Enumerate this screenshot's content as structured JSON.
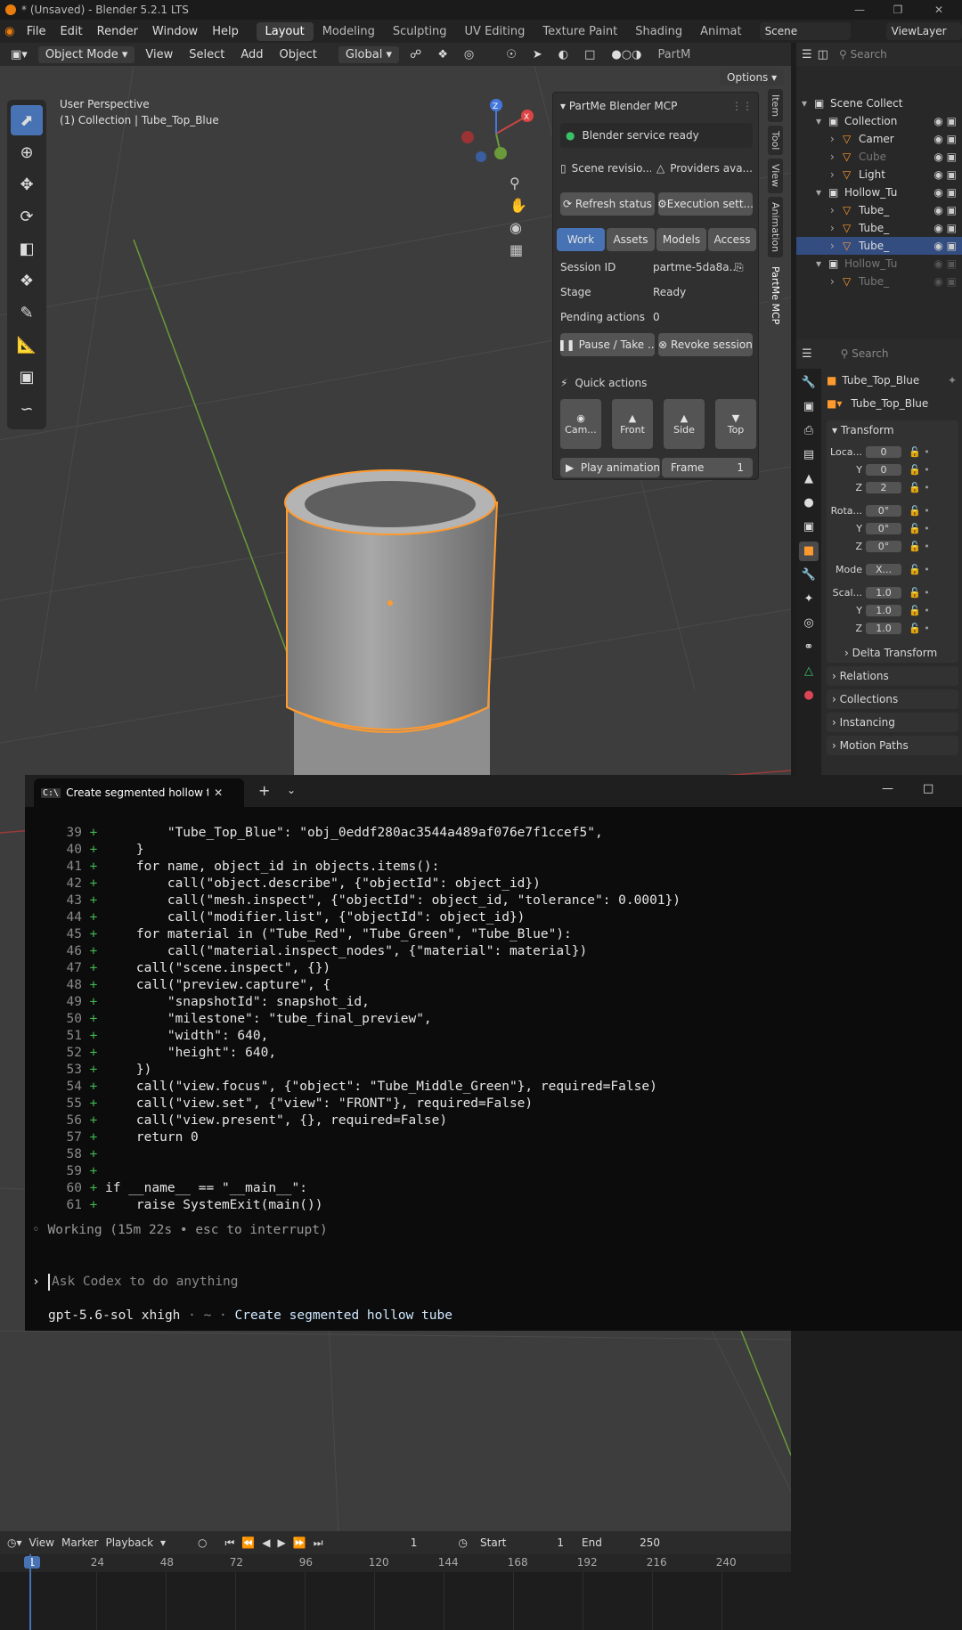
{
  "titlebar": {
    "title": "* (Unsaved) - Blender 5.2.1 LTS"
  },
  "menubar": {
    "menus": [
      "File",
      "Edit",
      "Render",
      "Window",
      "Help"
    ],
    "workspaces": [
      "Layout",
      "Modeling",
      "Sculpting",
      "UV Editing",
      "Texture Paint",
      "Shading",
      "Animat"
    ],
    "scene": "Scene",
    "view_layer": "ViewLayer"
  },
  "view3d_header": {
    "mode": "Object Mode",
    "menus": [
      "View",
      "Select",
      "Add",
      "Object"
    ],
    "orientation": "Global",
    "options": "Options",
    "partme_tab": "PartM"
  },
  "viewport": {
    "perspective": "User Perspective",
    "collection_info": "(1) Collection | Tube_Top_Blue",
    "gizmo": {
      "x_label": "X",
      "z_label": "Z"
    }
  },
  "npanel": {
    "title": "PartMe Blender MCP",
    "status": "Blender service ready",
    "scene_revision": "Scene revisio...",
    "providers": "Providers ava...",
    "refresh": "Refresh status",
    "execution": "Execution sett...",
    "tabs": [
      "Work",
      "Assets",
      "Models",
      "Access"
    ],
    "session_label": "Session ID",
    "session_value": "partme-5da8a...",
    "stage_label": "Stage",
    "stage_value": "Ready",
    "pending_label": "Pending actions",
    "pending_value": "0",
    "pause": "Pause / Take ...",
    "revoke": "Revoke session",
    "quick_actions": "Quick actions",
    "views": [
      "Cam...",
      "Front",
      "Side",
      "Top"
    ],
    "play": "Play animation",
    "frame_label": "Frame",
    "frame_value": "1"
  },
  "side_tabs": [
    "Item",
    "Tool",
    "View",
    "Animation",
    "PartMe MCP"
  ],
  "outliner": {
    "search_placeholder": "Search",
    "rows": [
      {
        "label": "Scene Collect",
        "indent": 0
      },
      {
        "label": "Collection",
        "indent": 1
      },
      {
        "label": "Camer",
        "indent": 2
      },
      {
        "label": "Cube",
        "indent": 2
      },
      {
        "label": "Light",
        "indent": 2
      },
      {
        "label": "Hollow_Tu",
        "indent": 1
      },
      {
        "label": "Tube_",
        "indent": 2
      },
      {
        "label": "Tube_",
        "indent": 2
      },
      {
        "label": "Tube_",
        "indent": 2
      },
      {
        "label": "Hollow_Tu",
        "indent": 1
      },
      {
        "label": "Tube_",
        "indent": 2
      }
    ]
  },
  "properties": {
    "search_placeholder": "Search",
    "object_name": "Tube_Top_Blue",
    "name_field": "Tube_Top_Blue",
    "transform": "Transform",
    "location_label": "Loca...",
    "location": [
      "0",
      "0",
      "2"
    ],
    "rotation_label": "Rota...",
    "rotation": [
      "0°",
      "0°",
      "0°"
    ],
    "mode_label": "Mode",
    "mode_value": "X...",
    "scale_label": "Scal...",
    "scale": [
      "1.0",
      "1.0",
      "1.0"
    ],
    "axis_y": "Y",
    "axis_z": "Z",
    "delta": "Delta Transform",
    "sections": [
      "Relations",
      "Collections",
      "Instancing",
      "Motion Paths"
    ]
  },
  "terminal": {
    "tab_title": "Create segmented hollow t",
    "lines": [
      {
        "n": "39",
        "t": "        \"Tube_Top_Blue\": \"obj_0eddf280ac3544a489af076e7f1ccef5\","
      },
      {
        "n": "40",
        "t": "    }"
      },
      {
        "n": "41",
        "t": "    for name, object_id in objects.items():"
      },
      {
        "n": "42",
        "t": "        call(\"object.describe\", {\"objectId\": object_id})"
      },
      {
        "n": "43",
        "t": "        call(\"mesh.inspect\", {\"objectId\": object_id, \"tolerance\": 0.0001})"
      },
      {
        "n": "44",
        "t": "        call(\"modifier.list\", {\"objectId\": object_id})"
      },
      {
        "n": "45",
        "t": "    for material in (\"Tube_Red\", \"Tube_Green\", \"Tube_Blue\"):"
      },
      {
        "n": "46",
        "t": "        call(\"material.inspect_nodes\", {\"material\": material})"
      },
      {
        "n": "47",
        "t": "    call(\"scene.inspect\", {})"
      },
      {
        "n": "48",
        "t": "    call(\"preview.capture\", {"
      },
      {
        "n": "49",
        "t": "        \"snapshotId\": snapshot_id,"
      },
      {
        "n": "50",
        "t": "        \"milestone\": \"tube_final_preview\","
      },
      {
        "n": "51",
        "t": "        \"width\": 640,"
      },
      {
        "n": "52",
        "t": "        \"height\": 640,"
      },
      {
        "n": "53",
        "t": "    })"
      },
      {
        "n": "54",
        "t": "    call(\"view.focus\", {\"object\": \"Tube_Middle_Green\"}, required=False)"
      },
      {
        "n": "55",
        "t": "    call(\"view.set\", {\"view\": \"FRONT\"}, required=False)"
      },
      {
        "n": "56",
        "t": "    call(\"view.present\", {}, required=False)"
      },
      {
        "n": "57",
        "t": "    return 0"
      },
      {
        "n": "58",
        "t": ""
      },
      {
        "n": "59",
        "t": ""
      },
      {
        "n": "60",
        "t": "if __name__ == \"__main__\":"
      },
      {
        "n": "61",
        "t": "    raise SystemExit(main())"
      }
    ],
    "working": "◦ Working (15m 22s • esc to interrupt)",
    "prompt_placeholder": "Ask Codex to do anything",
    "status_model": "gpt-5.6-sol xhigh",
    "status_sep": " · ~ · ",
    "status_task": "Create segmented hollow tube"
  },
  "timeline": {
    "menus": [
      "View",
      "Marker",
      "Playback"
    ],
    "current_frame": "1",
    "start_label": "Start",
    "start_value": "1",
    "end_label": "End",
    "end_value": "250",
    "ticks": [
      "1",
      "24",
      "48",
      "72",
      "96",
      "120",
      "144",
      "168",
      "192",
      "216",
      "240"
    ]
  },
  "colors": {
    "accent": "#4772b3",
    "selection": "#ff9a2e",
    "terminal_bg": "#0c0c0c",
    "diff_plus": "#3fb950"
  }
}
